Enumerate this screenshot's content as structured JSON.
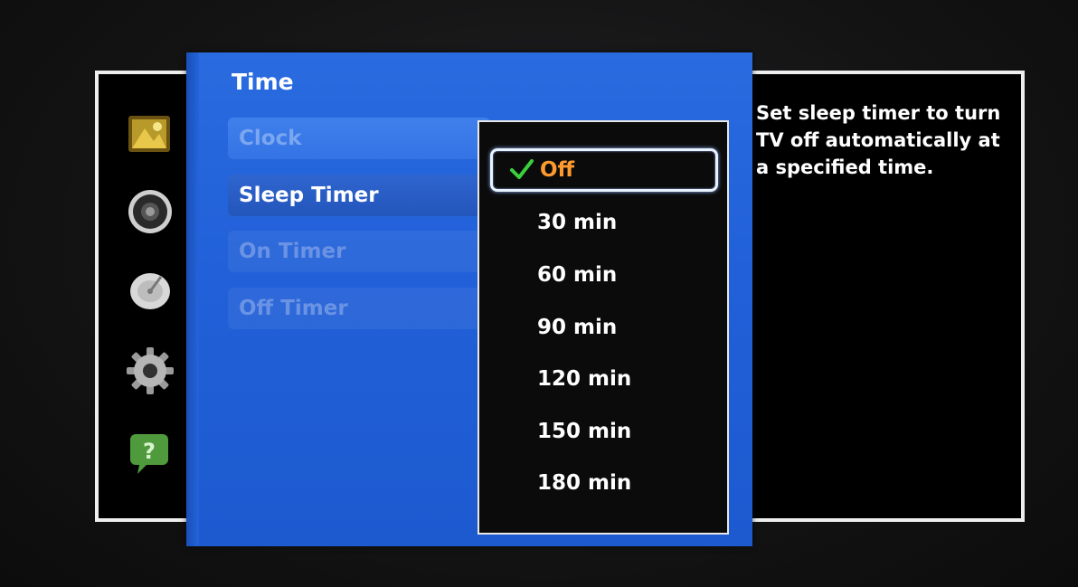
{
  "panel": {
    "title": "Time",
    "items": [
      {
        "label": "Clock",
        "state": "dim"
      },
      {
        "label": "Sleep Timer",
        "state": "selected"
      },
      {
        "label": "On Timer",
        "state": "disabled"
      },
      {
        "label": "Off Timer",
        "state": "disabled"
      }
    ]
  },
  "dropdown": {
    "selected": "Off",
    "options": [
      "Off",
      "30 min",
      "60 min",
      "90 min",
      "120 min",
      "150 min",
      "180 min"
    ]
  },
  "help_text": "Set sleep timer to turn TV off automatically at a specified time.",
  "side_icons": [
    "picture-icon",
    "sound-icon",
    "broadcast-icon",
    "settings-gear-icon",
    "support-icon"
  ],
  "colors": {
    "panel_blue": "#2263da",
    "selected_option_text": "#ff9b2e",
    "check_green": "#3ccf3c"
  }
}
